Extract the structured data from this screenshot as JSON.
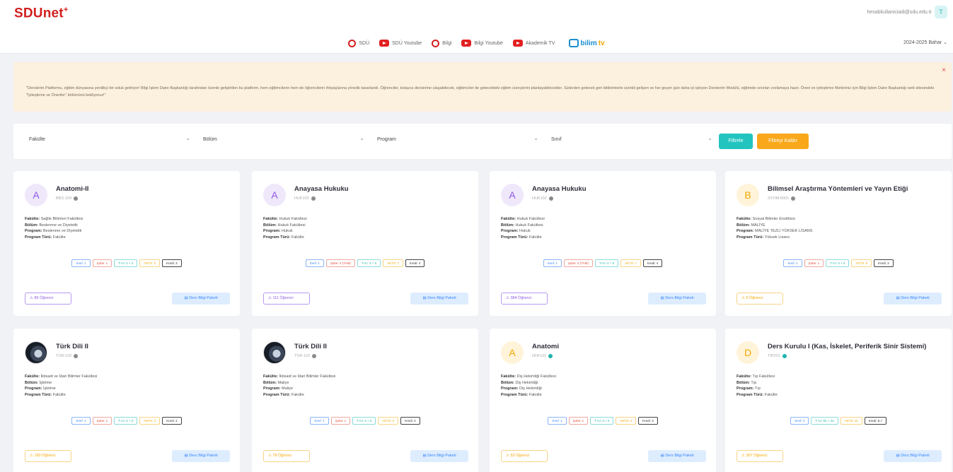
{
  "header": {
    "logo": "SDUnet",
    "logo_mark": "+",
    "user_email": "hesabkullaniciadi@sdu.edu.tr",
    "user_initial": "T",
    "term": "2024-2025 Bahar",
    "links": [
      {
        "label": "SDÜ",
        "icon": "sdu-logo-icon"
      },
      {
        "label": "SDÜ Youtube",
        "icon": "youtube-icon"
      },
      {
        "label": "Bilgi",
        "icon": "bilgi-logo-icon"
      },
      {
        "label": "Bilgi Youtube",
        "icon": "youtube-icon"
      },
      {
        "label": "Akademik TV",
        "icon": "youtube-icon"
      }
    ],
    "bilimtv": {
      "text_main": "bilim",
      "text_tv": "tv"
    }
  },
  "banner": {
    "text": "\"Derslerim Platformu, eğitim dünyasına yenilikçi bir soluk getiriyor! Bilgi İşlem Daire Başkanlığı tarafından özenle geliştirilen bu platform, hem eğitimcilerin hem de öğrencilerin ihtiyaçlarına yönelik tasarlandı. Öğrenciler, kolayca derslerine ulaşabilecek, eğitimciler de gelecekteki eğitim süreçlerini planlayabilecekler. Sizlerden gelecek geri bildirimlerle sürekli gelişen ve her geçen gün daha iyi işleyen Derslerim Modülü, eğitimde sınırları zorlamaya hazır. Öneri ve iyileştirme fikirleriniz için Bilgi İşlem Daire Başkanlığı web sitesindeki \"İyileştirme ve Öneriler\" bölümünü bekliyoruz!\"",
    "close_icon": "close-icon"
  },
  "filters": {
    "selects": [
      "Fakülte",
      "Bölüm",
      "Program",
      "Sınıf"
    ],
    "filter_button": "Filtrele",
    "clear_button": "Filtreyi Kaldır"
  },
  "labels": {
    "faculty": "Fakülte:",
    "department": "Bölüm:",
    "program": "Program:",
    "program_type": "Program Türü:",
    "info_button": "Ders Bilgi Paketi"
  },
  "cards": [
    {
      "title": "Anatomi-II",
      "code": "BBS-109",
      "avatar_letter": "A",
      "avatar": "a",
      "faculty": "Sağlık Bilimleri Fakültesi",
      "department": "Beslenme ve Diyetetik",
      "program": "Beslenme ve Diyetetik",
      "program_type": "Fakülte",
      "badges": [
        "Sınıf: 1",
        "Şube: 1",
        "T+U: 2 + 2",
        "AKTS: 3",
        "Kredi: 3"
      ],
      "badge_colors": [
        "blue",
        "red",
        "teal",
        "orange",
        "dark"
      ],
      "students": "86 Öğrenci",
      "student_color": "purple",
      "dot": "gray"
    },
    {
      "title": "Anayasa Hukuku",
      "code": "HUK102",
      "avatar_letter": "A",
      "avatar": "a",
      "faculty": "Hukuk Fakültesi",
      "department": "Hukuk Fakültesi",
      "program": "Hukuk",
      "program_type": "Fakülte",
      "badges": [
        "Sınıf: 1",
        "Şube: 4 (TAM)",
        "T+U: 4 + 0",
        "AKTS: 7",
        "Kredi: 4"
      ],
      "badge_colors": [
        "blue",
        "red",
        "teal",
        "orange",
        "dark"
      ],
      "students": "111 Öğrenci",
      "student_color": "purple",
      "dot": "gray"
    },
    {
      "title": "Anayasa Hukuku",
      "code": "HUK102",
      "avatar_letter": "A",
      "avatar": "a",
      "faculty": "Hukuk Fakültesi",
      "department": "Hukuk Fakültesi",
      "program": "Hukuk",
      "program_type": "Fakülte",
      "badges": [
        "Sınıf: 1",
        "Şube: 4 (TAM)",
        "T+U: 4 + 0",
        "AKTS: 7",
        "Kredi: 4"
      ],
      "badge_colors": [
        "blue",
        "red",
        "teal",
        "orange",
        "dark"
      ],
      "students": "384 Öğrenci",
      "student_color": "purple",
      "dot": "gray"
    },
    {
      "title": "Bilimsel Araştırma Yöntemleri ve Yayın Etiği",
      "code": "SYOM-5001",
      "avatar_letter": "B",
      "avatar": "b",
      "faculty": "Sosyal Bilimler Enstitüsü",
      "department": "MALİYE",
      "program": "MALİYE TEZLİ YÜKSEK LİSANS",
      "program_type": "Yüksek Lisans",
      "badges": [
        "Sınıf: 1",
        "Şube: 1",
        "T+U: 3 + 0",
        "AKTS: 6",
        "Kredi: 3"
      ],
      "badge_colors": [
        "blue",
        "red",
        "teal",
        "orange",
        "dark"
      ],
      "students": "5 Öğrenci",
      "student_color": "amber",
      "dot": "gray"
    },
    {
      "title": "Türk Dili II",
      "code": "TÜR-102",
      "avatar_letter": "",
      "avatar": "img",
      "faculty": "İktisadi ve İdari Bilimler Fakültesi",
      "department": "İşletme",
      "program": "İşletme",
      "program_type": "Fakülte",
      "badges": [
        "Sınıf: 1",
        "Şube: 1",
        "T+U: 2 + 0",
        "AKTS: 2",
        "Kredi: 2"
      ],
      "badge_colors": [
        "blue",
        "red",
        "teal",
        "orange",
        "dark"
      ],
      "students": "190 Öğrenci",
      "student_color": "amber",
      "dot": "gray"
    },
    {
      "title": "Türk Dili II",
      "code": "TÜR-102",
      "avatar_letter": "",
      "avatar": "img",
      "faculty": "İktisadi ve İdari Bilimler Fakültesi",
      "department": "Maliye",
      "program": "Maliye",
      "program_type": "Fakülte",
      "badges": [
        "Sınıf: 1",
        "Şube: 1",
        "T+U: 2 + 0",
        "AKTS: 2",
        "Kredi: 2"
      ],
      "badge_colors": [
        "blue",
        "red",
        "teal",
        "orange",
        "dark"
      ],
      "students": "78 Öğrenci",
      "student_color": "amber",
      "dot": "gray"
    },
    {
      "title": "Anatomi",
      "code": "DHF101",
      "avatar_letter": "A",
      "avatar": "b",
      "faculty": "Diş Hekimliği Fakültesi",
      "department": "Diş Hekimliği",
      "program": "Diş Hekimliği",
      "program_type": "Fakülte",
      "badges": [
        "Sınıf: 1",
        "Şube: 1",
        "T+U: 3 + 0",
        "AKTS: 4",
        "Kredi: 3"
      ],
      "badge_colors": [
        "blue",
        "red",
        "teal",
        "orange",
        "dark"
      ],
      "students": "53 Öğrenci",
      "student_color": "amber",
      "dot": "green"
    },
    {
      "title": "Ders Kurulu I (Kas, İskelet, Periferik Sinir Sistemi)",
      "code": "TIP201",
      "avatar_letter": "D",
      "avatar": "b",
      "faculty": "Tıp Fakültesi",
      "department": "Tıp",
      "program": "Tıp",
      "program_type": "Fakülte",
      "badges": [
        "Sınıf: 2",
        "T+U: 84 + 24",
        "AKTS: 11",
        "Kredi: 8.7"
      ],
      "badge_colors": [
        "blue",
        "teal",
        "orange",
        "dark"
      ],
      "students": "307 Öğrenci",
      "student_color": "amber",
      "dot": "green"
    }
  ]
}
